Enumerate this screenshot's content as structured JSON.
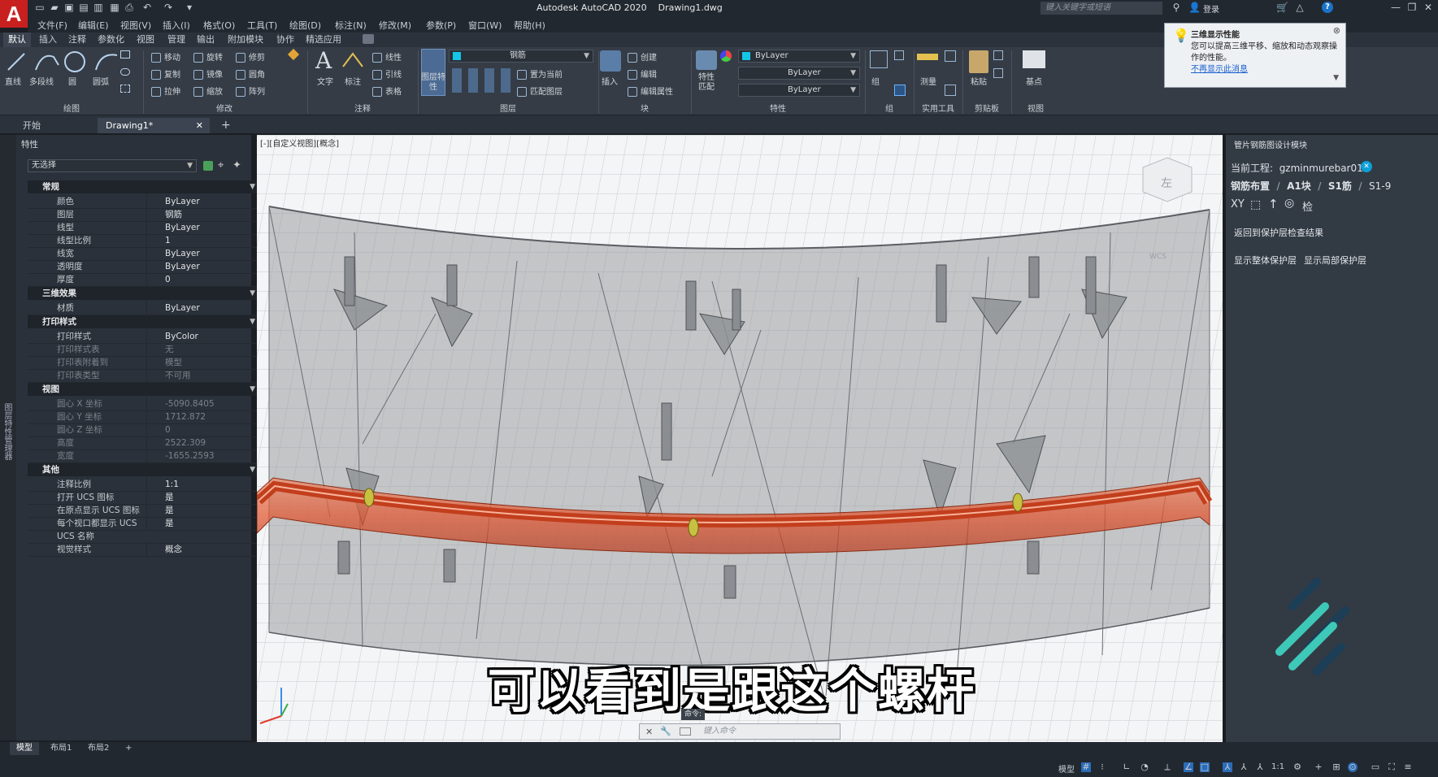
{
  "app": {
    "title": "Autodesk AutoCAD 2020",
    "document": "Drawing1.dwg",
    "logo": "A",
    "search_placeholder": "键入关键字或短语",
    "login": "登录"
  },
  "menu": [
    "文件(F)",
    "编辑(E)",
    "视图(V)",
    "插入(I)",
    "格式(O)",
    "工具(T)",
    "绘图(D)",
    "标注(N)",
    "修改(M)",
    "参数(P)",
    "窗口(W)",
    "帮助(H)"
  ],
  "ribbon_tabs": [
    "默认",
    "插入",
    "注释",
    "参数化",
    "视图",
    "管理",
    "输出",
    "附加模块",
    "协作",
    "精选应用"
  ],
  "ribbon": {
    "draw_tools": [
      "直线",
      "多段线",
      "圆",
      "圆弧"
    ],
    "modify_tools": [
      "移动",
      "旋转",
      "修剪",
      "复制",
      "镜像",
      "圆角",
      "拉伸",
      "缩放",
      "阵列"
    ],
    "annotation_tools": [
      "文字",
      "标注"
    ],
    "annotation_small": [
      "线性",
      "引线",
      "表格"
    ],
    "layer_props": "图层特性",
    "layer_name": "钢筋",
    "layer_actions": [
      "置为当前",
      "匹配图层"
    ],
    "insert": "插入",
    "block_actions": [
      "创建",
      "编辑",
      "编辑属性"
    ],
    "match_props": "特性匹配",
    "bylayer": [
      "ByLayer",
      "ByLayer",
      "ByLayer"
    ],
    "group": "组",
    "measure": "测量",
    "paste": "粘贴",
    "base": "基点",
    "groups": [
      "绘图",
      "修改",
      "注释",
      "图层",
      "块",
      "特性",
      "组",
      "实用工具",
      "剪贴板",
      "视图"
    ]
  },
  "notification": {
    "title": "三维显示性能",
    "body": "您可以提高三维平移、缩放和动态观察操作的性能。",
    "link": "不再显示此消息"
  },
  "doc_tabs": [
    "开始",
    "Drawing1*"
  ],
  "properties": {
    "title": "特性",
    "selection": "无选择",
    "side_label": "图层特性管理器",
    "sections": [
      {
        "name": "常规",
        "rows": [
          [
            "颜色",
            "ByLayer"
          ],
          [
            "图层",
            "钢筋"
          ],
          [
            "线型",
            "ByLayer"
          ],
          [
            "线型比例",
            "1"
          ],
          [
            "线宽",
            "ByLayer"
          ],
          [
            "透明度",
            "ByLayer"
          ],
          [
            "厚度",
            "0"
          ]
        ]
      },
      {
        "name": "三维效果",
        "rows": [
          [
            "材质",
            "ByLayer"
          ]
        ]
      },
      {
        "name": "打印样式",
        "rows": [
          [
            "打印样式",
            "ByColor"
          ],
          [
            "打印样式表",
            "无"
          ],
          [
            "打印表附着到",
            "模型"
          ],
          [
            "打印表类型",
            "不可用"
          ]
        ]
      },
      {
        "name": "视图",
        "rows": [
          [
            "圆心 X 坐标",
            "-5090.8405"
          ],
          [
            "圆心 Y 坐标",
            "1712.872"
          ],
          [
            "圆心 Z 坐标",
            "0"
          ],
          [
            "高度",
            "2522.309"
          ],
          [
            "宽度",
            "-1655.2593"
          ]
        ]
      },
      {
        "name": "其他",
        "rows": [
          [
            "注释比例",
            "1:1"
          ],
          [
            "打开 UCS 图标",
            "是"
          ],
          [
            "在原点显示 UCS 图标",
            "是"
          ],
          [
            "每个视口都显示 UCS",
            "是"
          ],
          [
            "UCS 名称",
            ""
          ],
          [
            "视觉样式",
            "概念"
          ]
        ]
      }
    ]
  },
  "viewport": {
    "label": "[-][自定义视图][概念]",
    "wcs": "WCS",
    "cube_face": "左"
  },
  "right_panel": {
    "title": "管片钢筋图设计模块",
    "project_label": "当前工程:",
    "project_name": "gzminmurebar01",
    "breadcrumb": [
      "钢筋布置",
      "A1块",
      "S1筋",
      "S1-9"
    ],
    "tools": [
      "XY",
      "检"
    ],
    "btn_back": "返回到保护层检查结果",
    "btn_whole": "显示整体保护层",
    "btn_local": "显示局部保护层"
  },
  "subtitle": "可以看到是跟这个螺杆",
  "command": {
    "label": "命令:",
    "placeholder": "键入命令"
  },
  "layout_tabs": [
    "模型",
    "布局1",
    "布局2"
  ],
  "status": {
    "model": "模型",
    "scale": "1:1"
  },
  "colors": {
    "accent": "#0b9fd8",
    "rebar": "#e2522b",
    "logo": "#c8201f",
    "brand_teal": "#3ec8b8",
    "brand_navy": "#1c3e57"
  }
}
